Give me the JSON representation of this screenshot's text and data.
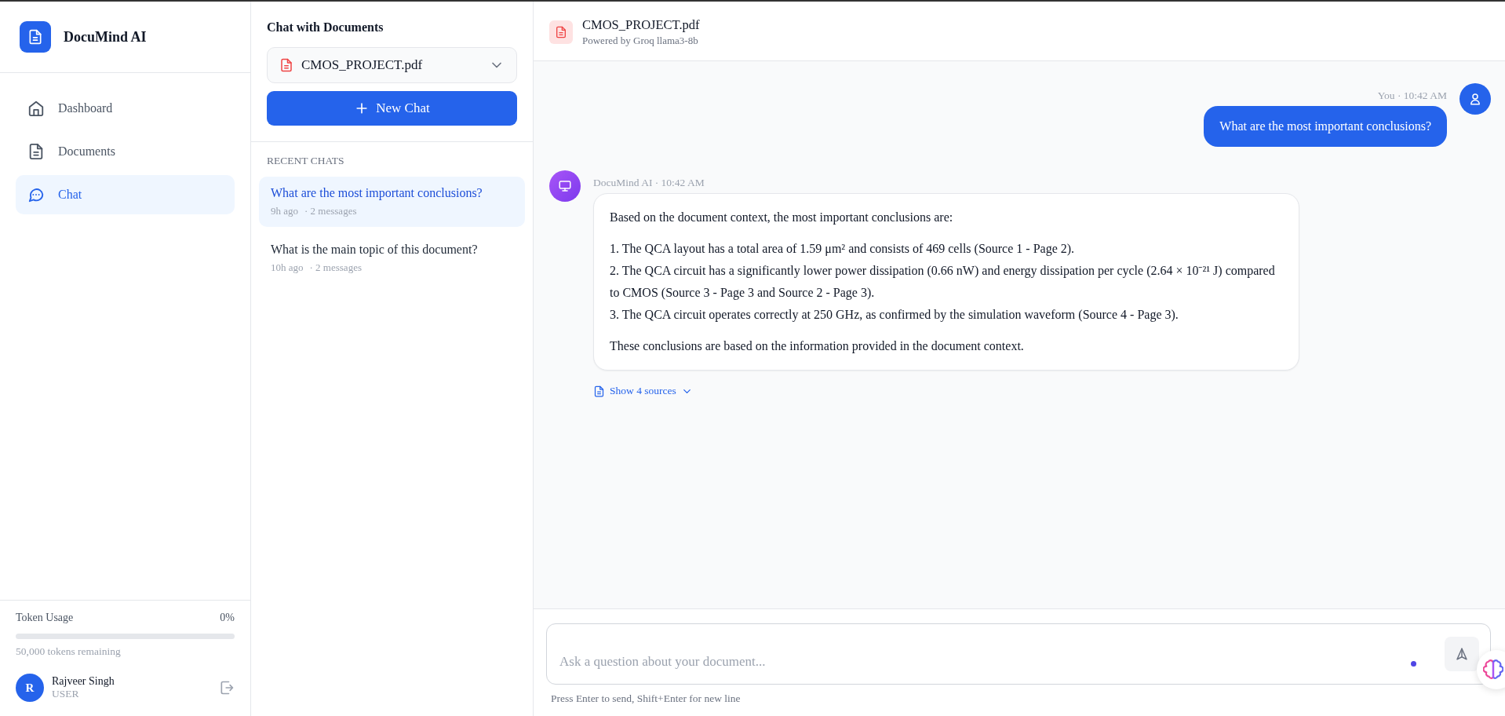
{
  "sidebar": {
    "app_title": "DocuMind AI",
    "nav": [
      {
        "label": "Dashboard",
        "selected": false
      },
      {
        "label": "Documents",
        "selected": false
      },
      {
        "label": "Chat",
        "selected": true
      }
    ],
    "token_usage": {
      "label": "Token Usage",
      "percent": "0%",
      "level": 0,
      "remaining": "50,000 tokens remaining"
    },
    "user": {
      "initial": "R",
      "name": "Rajveer Singh",
      "role": "USER"
    }
  },
  "chat_panel": {
    "title": "Chat with Documents",
    "document_select": {
      "value": "CMOS_PROJECT.pdf"
    },
    "new_chat_button": "New Chat",
    "recent_heading": "RECENT CHATS",
    "recent_chats": [
      {
        "title": "What are the most important conclusions?",
        "time": "9h ago",
        "count": "· 2 messages",
        "selected": true
      },
      {
        "title": "What is the main topic of this document?",
        "time": "10h ago",
        "count": "· 2 messages",
        "selected": false
      }
    ]
  },
  "header": {
    "title": "CMOS_PROJECT.pdf",
    "subtitle": "Powered by Groq llama3-8b"
  },
  "messages": [
    {
      "kind": "user",
      "meta": "You · 10:42 AM",
      "blocks": [
        {
          "kind": "paragraph",
          "text": "What are the most important conclusions?"
        }
      ]
    },
    {
      "kind": "assistant",
      "meta": "DocuMind AI · 10:42 AM",
      "blocks": [
        {
          "kind": "paragraph",
          "text": "Based on the document context, the most important conclusions are:"
        },
        {
          "kind": "list",
          "items": [
            "1. The QCA layout has a total area of 1.59 μm² and consists of 469 cells (Source 1 - Page 2).",
            "2. The QCA circuit has a significantly lower power dissipation (0.66 nW) and energy dissipation per cycle (2.64 × 10⁻²¹ J) compared to CMOS (Source 3 - Page 3 and Source 2 - Page 3).",
            "3. The QCA circuit operates correctly at 250 GHz, as confirmed by the simulation waveform (Source 4 - Page 3)."
          ]
        },
        {
          "kind": "paragraph",
          "text": "These conclusions are based on the information provided in the document context."
        }
      ],
      "sources_link": "Show 4 sources"
    }
  ],
  "composer": {
    "placeholder": "Ask a question about your document...",
    "hint": "Press Enter to send, Shift+Enter for new line"
  }
}
